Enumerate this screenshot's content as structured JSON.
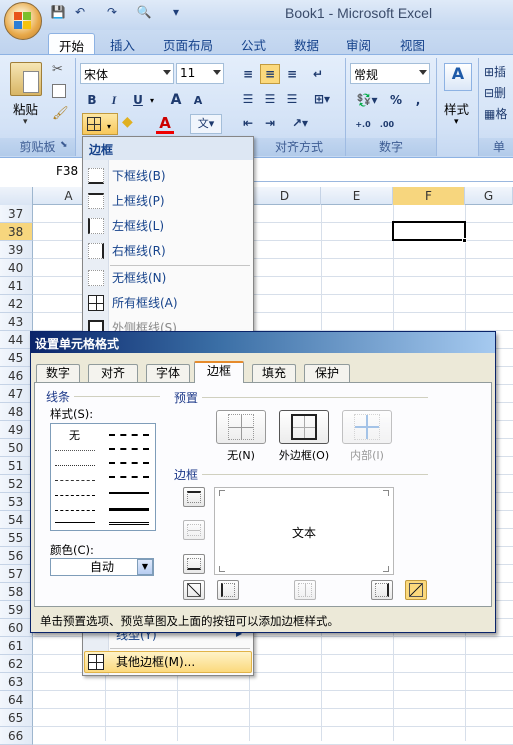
{
  "window": {
    "title": "Book1 - Microsoft Excel"
  },
  "qat": {
    "save": "💾",
    "undo": "↶",
    "redo": "↷",
    "print_preview": "🔍",
    "more": "▾"
  },
  "tabs": [
    "开始",
    "插入",
    "页面布局",
    "公式",
    "数据",
    "审阅",
    "视图"
  ],
  "ribbon": {
    "paste_label": "粘贴",
    "font_name": "宋体",
    "font_size": "11",
    "bold": "B",
    "italic": "I",
    "underline": "U",
    "grow_font": "A",
    "shrink_font": "A",
    "number_format": "常规",
    "percent": "%",
    "comma": ",",
    "styles_label": "样式",
    "groups": {
      "clipboard": "剪贴板",
      "alignment": "对齐方式",
      "number": "数字",
      "cells": "单元"
    },
    "inc_decimal": "+.0",
    "dec_decimal": ".00"
  },
  "name_box": "F38",
  "columns": [
    "A",
    "D",
    "E",
    "F",
    "G"
  ],
  "rows": [
    "37",
    "38",
    "39",
    "40",
    "41",
    "42",
    "43",
    "44",
    "45",
    "46",
    "47",
    "48",
    "49",
    "50",
    "51",
    "52",
    "53",
    "54",
    "55",
    "56",
    "57",
    "58",
    "59",
    "60",
    "61",
    "62",
    "63",
    "64",
    "65",
    "66"
  ],
  "selected_row": "38",
  "border_menu": {
    "header": "边框",
    "items": [
      "下框线(B)",
      "上框线(P)",
      "左框线(L)",
      "右框线(R)",
      "无框线(N)",
      "所有框线(A)",
      "外侧框线(S)"
    ],
    "bottom_items": [
      "线型(Y)",
      "其他边框(M)..."
    ]
  },
  "dialog": {
    "title": "设置单元格格式",
    "tabs": [
      "数字",
      "对齐",
      "字体",
      "边框",
      "填充",
      "保护"
    ],
    "active_tab": "边框",
    "line_group": "线条",
    "style_label": "样式(S):",
    "none_style": "无",
    "color_label": "颜色(C):",
    "color_value": "自动",
    "preset_group": "预置",
    "presets": [
      "无(N)",
      "外边框(O)",
      "内部(I)"
    ],
    "border_group": "边框",
    "preview_text": "文本",
    "hint": "单击预置选项、预览草图及上面的按钮可以添加边框样式。"
  },
  "colors": {
    "accent": "#15428b",
    "selected_row": "#f7d67e",
    "highlight_menu": "#fbd97d"
  }
}
